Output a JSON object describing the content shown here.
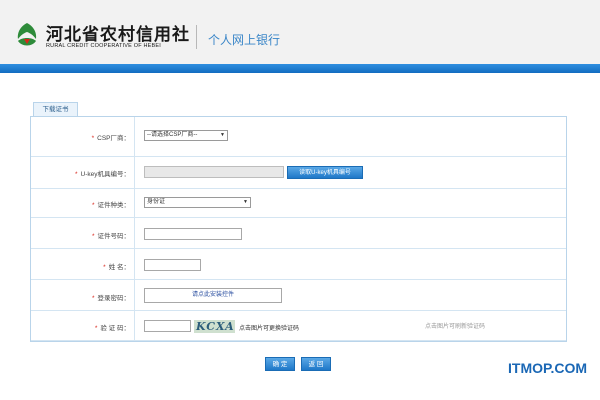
{
  "header": {
    "logo_cn": "河北省农村信用社",
    "logo_en": "RURAL CREDIT COOPERATIVE OF HEBEI",
    "site_name": "个人网上银行"
  },
  "cert_form": {
    "tab_label": "下载证书",
    "required_mark": "*",
    "rows": [
      {
        "label": "CSP厂商：",
        "control": "select",
        "value": "--请选择CSP厂商--"
      },
      {
        "label": "U-key机具编号：",
        "control": "input-disabled",
        "button": "读取U-key机具编号"
      },
      {
        "label": "证件种类：",
        "control": "select",
        "value": "身份证"
      },
      {
        "label": "证件号码：",
        "control": "input"
      },
      {
        "label": "姓 名：",
        "control": "input"
      },
      {
        "label": "登录密码：",
        "control": "password",
        "value": "请点此安装控件"
      },
      {
        "label": "验 证 码：",
        "control": "captcha",
        "captcha_text": "KCXA",
        "hint": "点击图片可更换验证码",
        "hint_right": "点击图片可刷新验证码"
      }
    ]
  },
  "buttons": {
    "ok": "确 定",
    "back": "返 回"
  },
  "watermark": "ITMOP.COM",
  "colors": {
    "brand_blue": "#1f78c8",
    "accent_green": "#2e8b3a",
    "required_red": "#d9261c"
  }
}
